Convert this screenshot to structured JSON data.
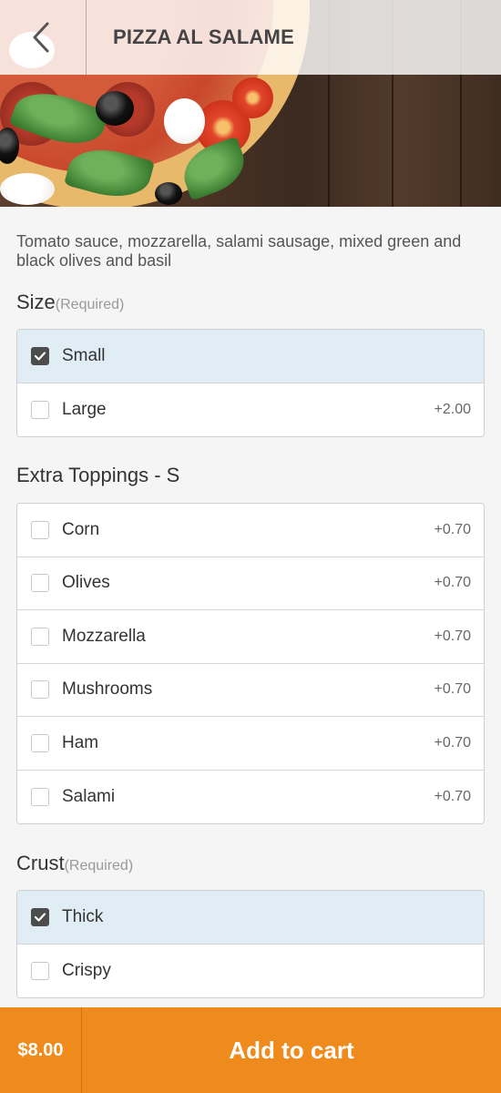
{
  "header": {
    "title": "PIZZA AL SALAME",
    "back_icon": "chevron-left-icon"
  },
  "product": {
    "description": "Tomato sauce, mozzarella, salami sausage, mixed green and black olives and basil"
  },
  "sections": {
    "size": {
      "title": "Size",
      "required": "(Required)",
      "options": [
        {
          "label": "Small",
          "price": "",
          "checked": true
        },
        {
          "label": "Large",
          "price": "+2.00",
          "checked": false
        }
      ]
    },
    "toppings": {
      "title": "Extra Toppings - S",
      "options": [
        {
          "label": "Corn",
          "price": "+0.70",
          "checked": false
        },
        {
          "label": "Olives",
          "price": "+0.70",
          "checked": false
        },
        {
          "label": "Mozzarella",
          "price": "+0.70",
          "checked": false
        },
        {
          "label": "Mushrooms",
          "price": "+0.70",
          "checked": false
        },
        {
          "label": "Ham",
          "price": "+0.70",
          "checked": false
        },
        {
          "label": "Salami",
          "price": "+0.70",
          "checked": false
        }
      ]
    },
    "crust": {
      "title": "Crust",
      "required": "(Required)",
      "options": [
        {
          "label": "Thick",
          "price": "",
          "checked": true
        },
        {
          "label": "Crispy",
          "price": "",
          "checked": false
        }
      ]
    }
  },
  "cart": {
    "total": "$8.00",
    "add_label": "Add to cart"
  },
  "colors": {
    "accent": "#ef8a1d",
    "selected_row": "#e1edf5",
    "checked_box": "#4d4d4d"
  }
}
